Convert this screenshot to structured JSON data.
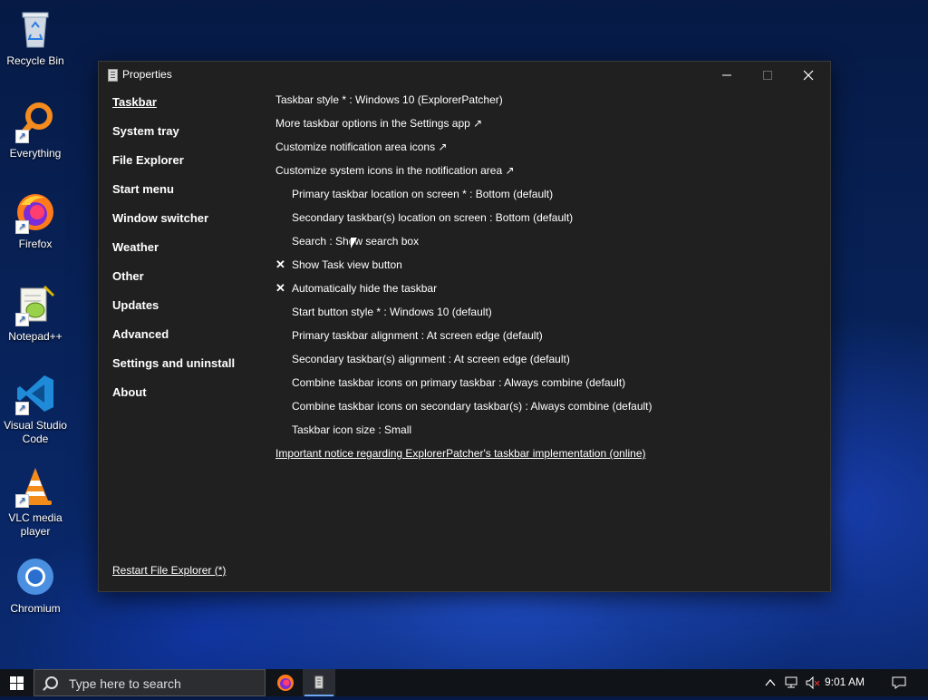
{
  "desktop": {
    "icons": [
      {
        "label": "Recycle Bin",
        "icon": "recycle-bin-icon"
      },
      {
        "label": "Everything",
        "icon": "everything-search-icon"
      },
      {
        "label": "Firefox",
        "icon": "firefox-icon"
      },
      {
        "label": "Notepad++",
        "icon": "notepad-plus-plus-icon"
      },
      {
        "label": "Visual Studio Code",
        "icon": "vscode-icon"
      },
      {
        "label": "VLC media player",
        "icon": "vlc-icon"
      },
      {
        "label": "Chromium",
        "icon": "chromium-icon"
      }
    ]
  },
  "window": {
    "title": "Properties",
    "nav": [
      {
        "label": "Taskbar",
        "active": true
      },
      {
        "label": "System tray"
      },
      {
        "label": "File Explorer"
      },
      {
        "label": "Start menu"
      },
      {
        "label": "Window switcher"
      },
      {
        "label": "Weather"
      },
      {
        "label": "Other"
      },
      {
        "label": "Updates"
      },
      {
        "label": "Advanced"
      },
      {
        "label": "Settings and uninstall"
      },
      {
        "label": "About"
      }
    ],
    "restart_link": "Restart File Explorer (*)",
    "settings": [
      {
        "text": "Taskbar style * : Windows 10 (ExplorerPatcher)"
      },
      {
        "text": "More taskbar options in the Settings app ↗"
      },
      {
        "text": "Customize notification area icons ↗"
      },
      {
        "text": "Customize system icons in the notification area ↗"
      },
      {
        "text": "Primary taskbar location on screen * : Bottom (default)"
      },
      {
        "text": "Secondary taskbar(s) location on screen : Bottom (default)"
      },
      {
        "text": "Search : Show search box"
      },
      {
        "text": "Show Task view button",
        "checked": true,
        "check_glyph": "✕"
      },
      {
        "text": "Automatically hide the taskbar",
        "checked": true,
        "check_glyph": "✕"
      },
      {
        "text": "Start button style * : Windows 10 (default)"
      },
      {
        "text": "Primary taskbar alignment : At screen edge (default)"
      },
      {
        "text": "Secondary taskbar(s) alignment : At screen edge (default)"
      },
      {
        "text": "Combine taskbar icons on primary taskbar : Always combine (default)"
      },
      {
        "text": "Combine taskbar icons on secondary taskbar(s) : Always combine (default)"
      },
      {
        "text": "Taskbar icon size : Small"
      },
      {
        "text": "Important notice regarding ExplorerPatcher's taskbar implementation (online)"
      }
    ]
  },
  "taskbar": {
    "search_placeholder": "Type here to search",
    "clock": "9:01 AM"
  }
}
